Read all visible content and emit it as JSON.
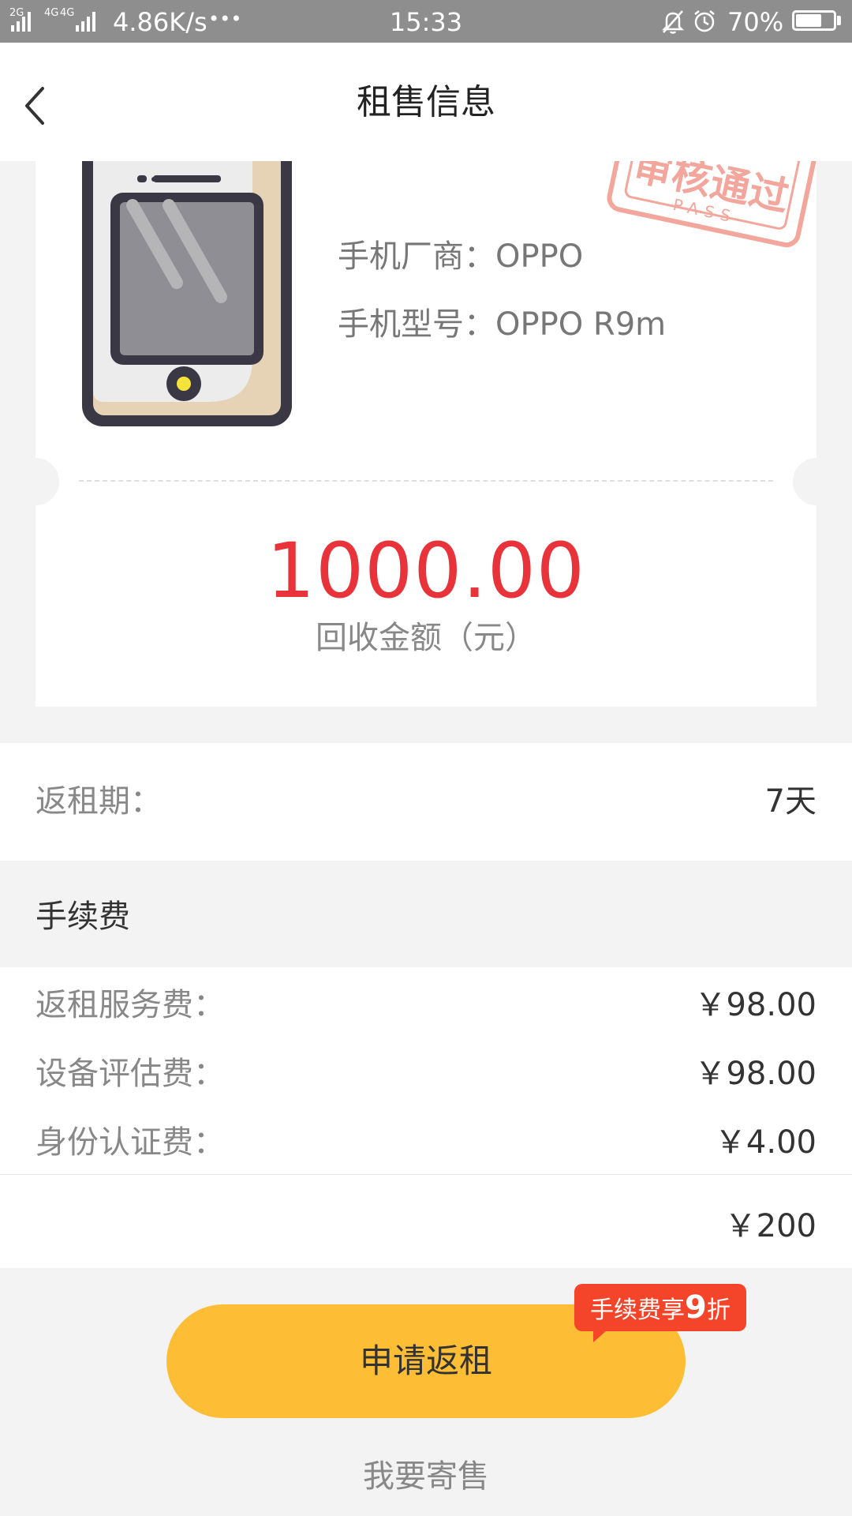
{
  "status_bar": {
    "network_2g": "2G",
    "network_4g": "4G",
    "network_4g2": "4G",
    "speed": "4.86K/s",
    "more": "•••",
    "time": "15:33",
    "battery": "70%",
    "battery_level": 0.7
  },
  "header": {
    "title": "租售信息"
  },
  "phone": {
    "vendor_label": "手机厂商：",
    "vendor": "OPPO",
    "model_label": "手机型号：",
    "model": "OPPO R9m"
  },
  "stamp": {
    "text": "审核通过",
    "sub": "PASS"
  },
  "amount": {
    "value": "1000.00",
    "label": "回收金额（元）"
  },
  "period": {
    "label": "返租期：",
    "value": "7天"
  },
  "fees": {
    "title": "手续费",
    "items": [
      {
        "label": "返租服务费：",
        "value": "￥98.00"
      },
      {
        "label": "设备评估费：",
        "value": "￥98.00"
      },
      {
        "label": "身份认证费：",
        "value": "￥4.00"
      }
    ],
    "total": "￥200"
  },
  "apply_button": {
    "label": "申请返租"
  },
  "badge": {
    "prefix": "手续费享",
    "number": "9",
    "suffix": "折"
  },
  "sell_link": "我要寄售",
  "colors": {
    "status_bar": "#8e8e8e",
    "amount": "#e8333a",
    "button": "#fdbd34",
    "badge": "#f4452a",
    "stamp": "#f3a69b",
    "background": "#f3f3f3"
  }
}
